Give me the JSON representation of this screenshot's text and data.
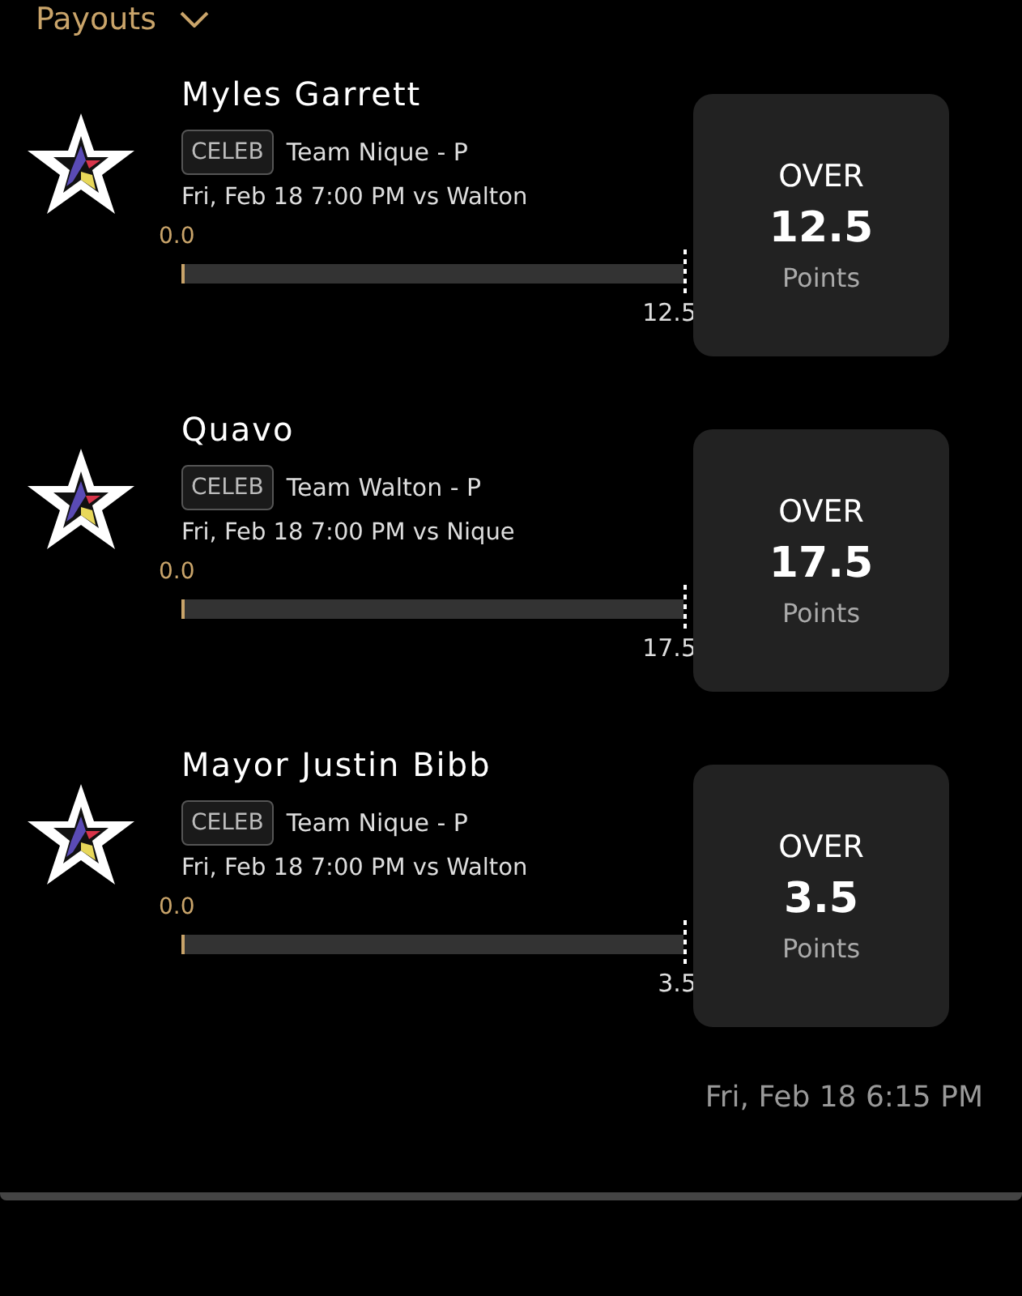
{
  "header": {
    "title": "Payouts"
  },
  "picks": [
    {
      "player": "Myles Garrett",
      "tag": "CELEB",
      "team": "Team Nique - P",
      "game": "Fri, Feb 18 7:00 PM vs Walton",
      "current": "0.0",
      "target": "12.5",
      "level": 0,
      "direction": "OVER",
      "line": "12.5",
      "stat": "Points"
    },
    {
      "player": "Quavo",
      "tag": "CELEB",
      "team": "Team Walton - P",
      "game": "Fri, Feb 18 7:00 PM vs Nique",
      "current": "0.0",
      "target": "17.5",
      "level": 0,
      "direction": "OVER",
      "line": "17.5",
      "stat": "Points"
    },
    {
      "player": "Mayor Justin Bibb",
      "tag": "CELEB",
      "team": "Team Nique - P",
      "game": "Fri, Feb 18 7:00 PM vs Walton",
      "current": "0.0",
      "target": "3.5",
      "level": 0,
      "direction": "OVER",
      "line": "3.5",
      "stat": "Points"
    }
  ],
  "timestamp": "Fri, Feb 18 6:15 PM"
}
